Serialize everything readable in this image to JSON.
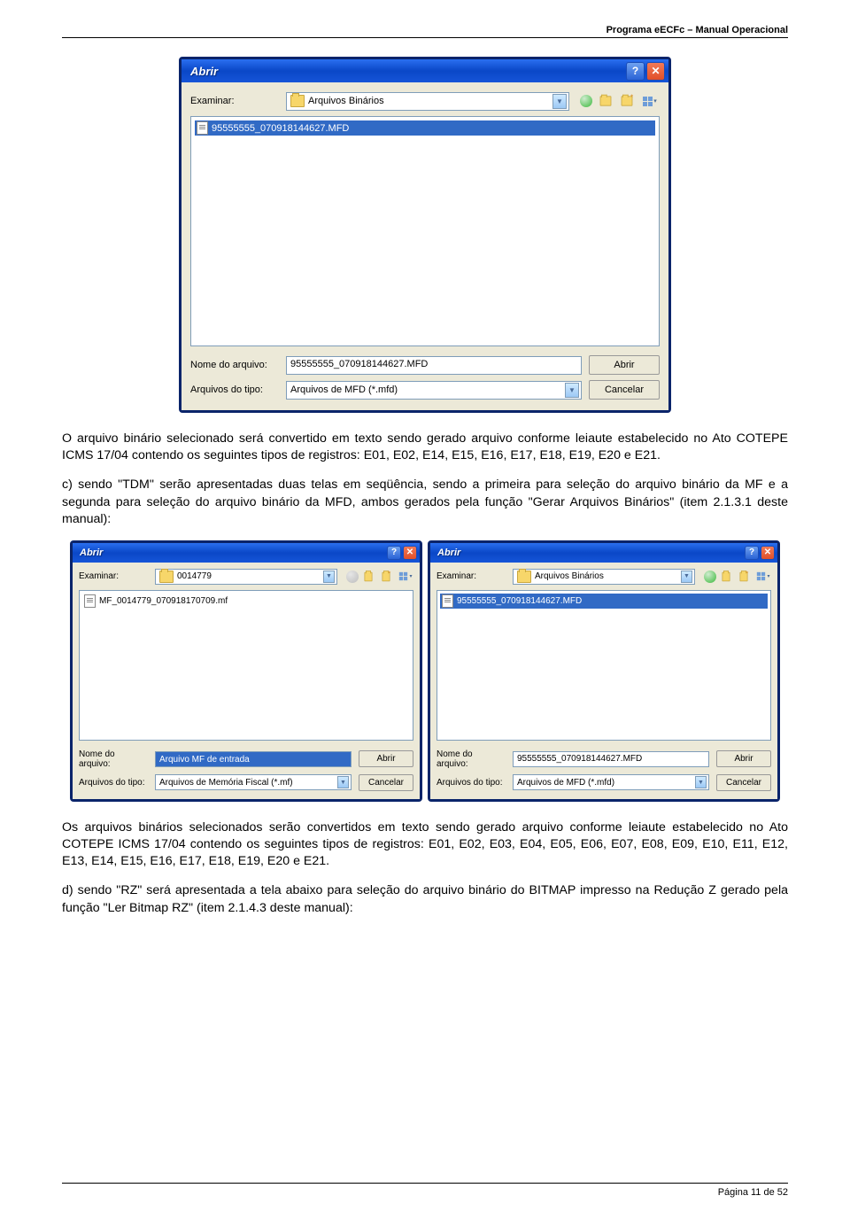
{
  "header": {
    "text": "Programa eECFc – Manual Operacional"
  },
  "footer": {
    "text": "Página 11 de 52"
  },
  "dialog1": {
    "title": "Abrir",
    "lookin_label": "Examinar:",
    "lookin_value": "Arquivos Binários",
    "file_item": "95555555_070918144627.MFD",
    "filename_label": "Nome do arquivo:",
    "filename_value": "95555555_070918144627.MFD",
    "filetype_label": "Arquivos do tipo:",
    "filetype_value": "Arquivos de MFD (*.mfd)",
    "open_btn": "Abrir",
    "cancel_btn": "Cancelar"
  },
  "para1": "O arquivo binário selecionado será convertido em texto sendo gerado arquivo conforme leiaute estabelecido no Ato COTEPE ICMS 17/04 contendo os seguintes tipos de registros: E01, E02, E14, E15, E16, E17, E18, E19, E20 e E21.",
  "para2": "c) sendo \"TDM\" serão apresentadas duas telas em seqüência, sendo a primeira para seleção do arquivo binário da MF e a segunda para seleção do arquivo binário da MFD, ambos gerados pela função \"Gerar Arquivos Binários\" (item 2.1.3.1 deste manual):",
  "dialog2": {
    "title": "Abrir",
    "lookin_label": "Examinar:",
    "lookin_value": "0014779",
    "file_item": "MF_0014779_070918170709.mf",
    "filename_label": "Nome do arquivo:",
    "filename_value": "Arquivo MF de entrada",
    "filetype_label": "Arquivos do tipo:",
    "filetype_value": "Arquivos de Memória Fiscal (*.mf)",
    "open_btn": "Abrir",
    "cancel_btn": "Cancelar"
  },
  "dialog3": {
    "title": "Abrir",
    "lookin_label": "Examinar:",
    "lookin_value": "Arquivos Binários",
    "file_item": "95555555_070918144627.MFD",
    "filename_label": "Nome do arquivo:",
    "filename_value": "95555555_070918144627.MFD",
    "filetype_label": "Arquivos do tipo:",
    "filetype_value": "Arquivos de MFD (*.mfd)",
    "open_btn": "Abrir",
    "cancel_btn": "Cancelar"
  },
  "para3": "Os arquivos binários selecionados serão convertidos em texto sendo gerado arquivo conforme leiaute estabelecido no Ato COTEPE ICMS 17/04 contendo os seguintes tipos de registros: E01, E02, E03, E04, E05, E06, E07, E08, E09, E10, E11, E12, E13, E14, E15, E16, E17, E18, E19, E20 e E21.",
  "para4": "d) sendo \"RZ\" será apresentada a tela abaixo para seleção do arquivo binário do BITMAP impresso na Redução Z gerado pela função \"Ler Bitmap RZ\" (item 2.1.4.3 deste manual):"
}
